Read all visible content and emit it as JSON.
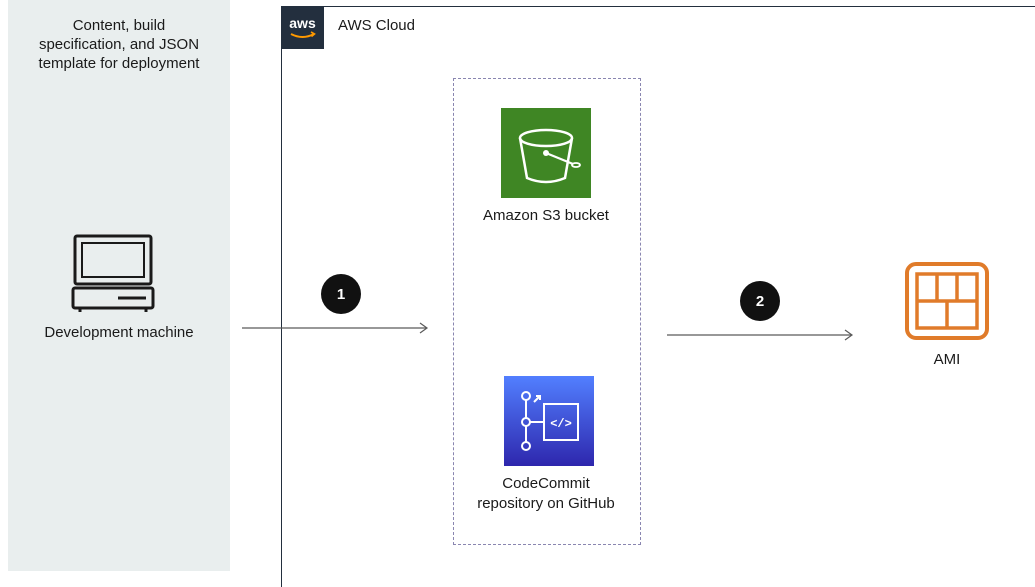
{
  "left_panel": {
    "caption_lines": [
      "Content, build",
      "specification, and JSON",
      "template for deployment"
    ],
    "dev_machine_label": "Development machine",
    "dev_icon": "computer-icon"
  },
  "cloud": {
    "logo_text": "aws",
    "label": "AWS Cloud"
  },
  "services": {
    "s3_label": "Amazon S3 bucket",
    "s3_icon": "s3-bucket-icon",
    "codecommit_label_lines": [
      "CodeCommit",
      "repository on GitHub"
    ],
    "codecommit_icon": "codecommit-icon"
  },
  "steps": {
    "step1": "1",
    "step2": "2"
  },
  "ami": {
    "label": "AMI",
    "icon": "ami-icon"
  },
  "colors": {
    "panel_bg": "#e9eeee",
    "aws_dark": "#232f3e",
    "s3_green": "#3f8624",
    "codecommit_blue": "#2e27ad",
    "ami_orange": "#e07b2a",
    "dashed_border": "#8a86b0"
  }
}
